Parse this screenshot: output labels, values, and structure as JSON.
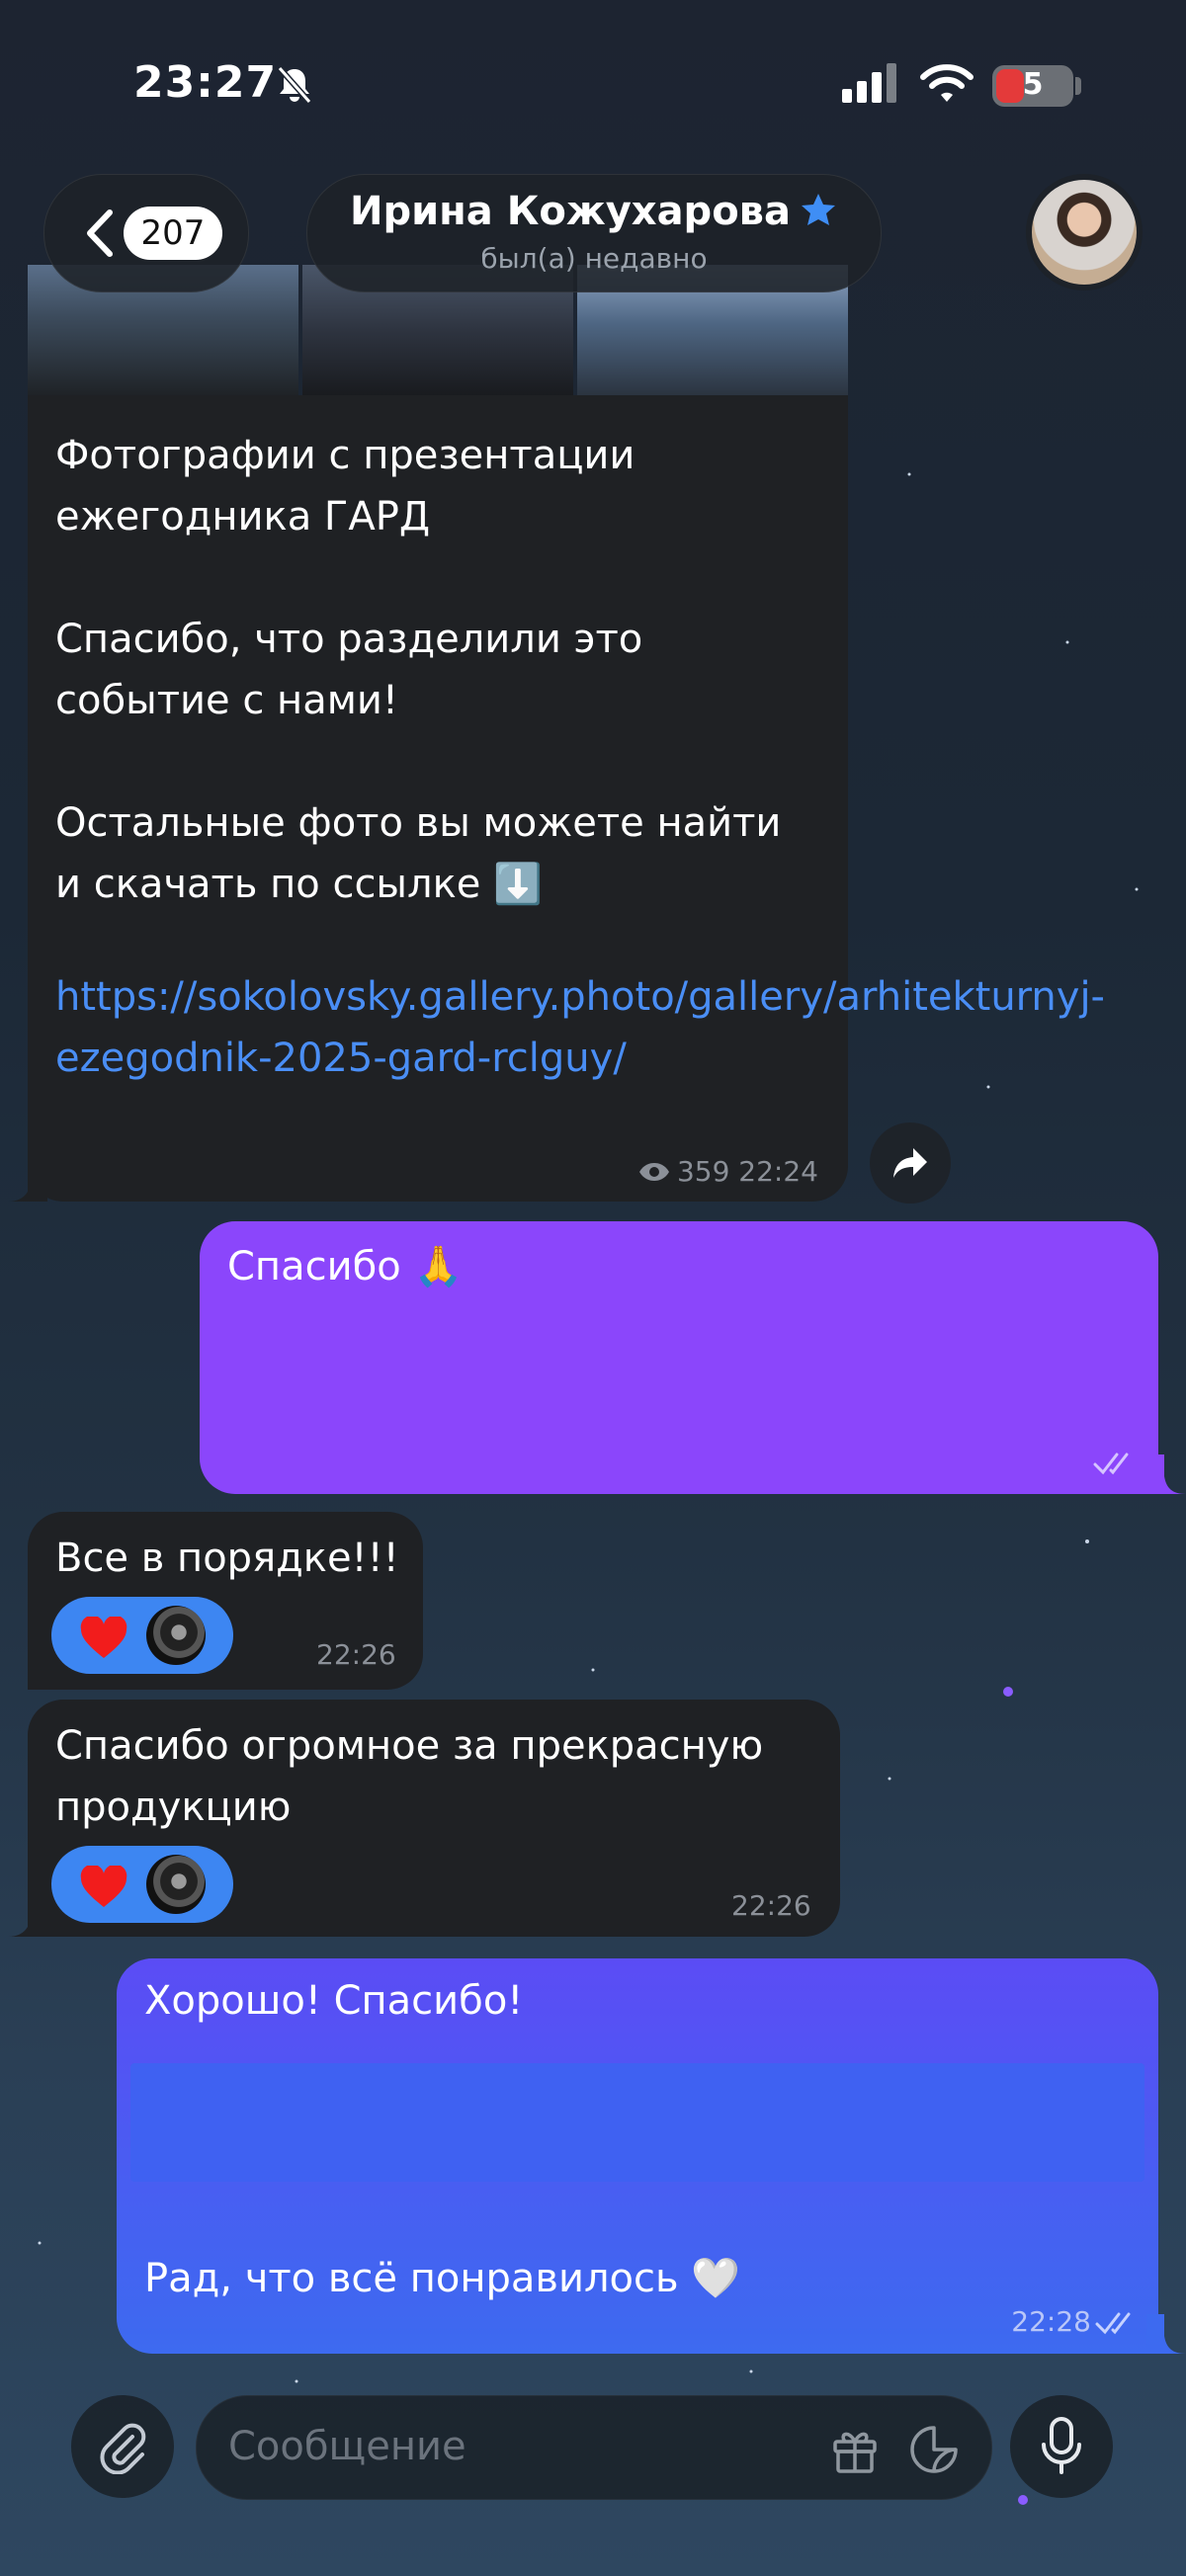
{
  "status_bar": {
    "time": "23:27",
    "battery": "5"
  },
  "header": {
    "back_count": "207",
    "contact_name": "Ирина Кожухарова",
    "contact_status": "был(а) недавно"
  },
  "messages": [
    {
      "text": "Фотографии с презентации\nежегодника ГАРД\n\nСпасибо, что разделили это\nсобытие с нами!\n\nОстальные фото вы можете найти\nи скачать по ссылке ⬇️",
      "link": "https://sokolovsky.gallery.photo/gallery/arhitekturnyj-ezegodnik-2025-gard-rclguy/",
      "views": "359",
      "time": "22:24"
    },
    {
      "text": "Спасибо 🙏"
    },
    {
      "text": "Все в порядке!!!",
      "time": "22:26"
    },
    {
      "text": "Спасибо огромное за прекрасную продукцию",
      "time": "22:26"
    },
    {
      "text": "Хорошо! Спасибо!",
      "text2": "Рад, что всё понравилось 🤍",
      "time": "22:28"
    }
  ],
  "input": {
    "placeholder": "Сообщение"
  },
  "icons": {
    "bell": "bell-slash-icon",
    "signal": "signal-icon",
    "wifi": "wifi-icon",
    "back": "chevron-left-icon",
    "verified": "star-icon",
    "views": "eye-icon",
    "share": "share-icon",
    "read": "double-check-icon",
    "reaction": "heart-icon",
    "attach": "paperclip-icon",
    "gift": "gift-icon",
    "sticker": "sticker-icon",
    "mic": "microphone-icon"
  },
  "colors": {
    "outgoing": "#8b46fb",
    "outgoing_alt": "#4a5cf2",
    "incoming": "#1f2124",
    "link": "#4a8ef5",
    "reaction": "#3d86f2"
  }
}
